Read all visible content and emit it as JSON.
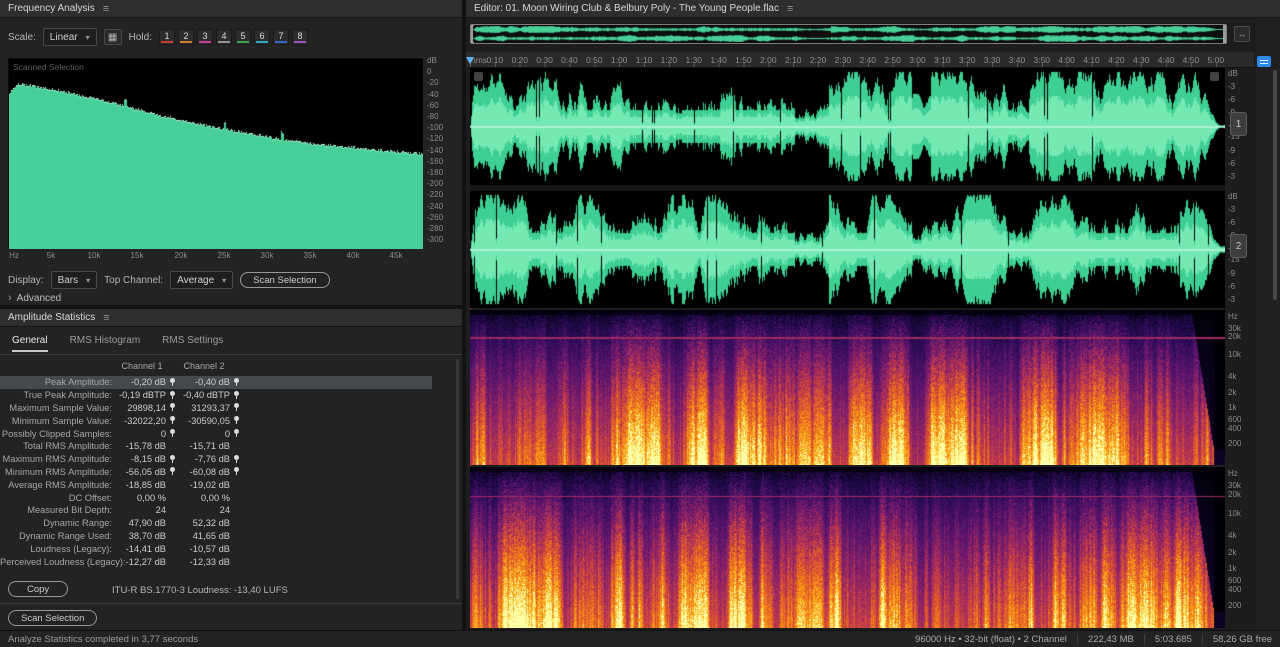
{
  "frequency_analysis": {
    "title": "Frequency Analysis",
    "scale_label": "Scale:",
    "scale_value": "Linear",
    "hold_label": "Hold:",
    "hold_buttons": [
      {
        "label": "1",
        "color": "#c8392f"
      },
      {
        "label": "2",
        "color": "#cf7c2a"
      },
      {
        "label": "3",
        "color": "#c73a96"
      },
      {
        "label": "4",
        "color": "#8f8f8f"
      },
      {
        "label": "5",
        "color": "#38a14b"
      },
      {
        "label": "6",
        "color": "#2fa7bd"
      },
      {
        "label": "7",
        "color": "#3465c8"
      },
      {
        "label": "8",
        "color": "#9b4fc4"
      }
    ],
    "graph_overlay": "Scanned Selection",
    "db_ticks": [
      "dB",
      "0",
      "-20",
      "-40",
      "-60",
      "-80",
      "-100",
      "-120",
      "-140",
      "-160",
      "-180",
      "-200",
      "-220",
      "-240",
      "-260",
      "-280",
      "-300"
    ],
    "freq_ticks": [
      "Hz",
      "5k",
      "10k",
      "15k",
      "20k",
      "25k",
      "30k",
      "35k",
      "40k",
      "45k"
    ],
    "display_label": "Display:",
    "display_value": "Bars",
    "top_channel_label": "Top Channel:",
    "top_channel_value": "Average",
    "scan_button": "Scan Selection",
    "advanced_label": "Advanced"
  },
  "amplitude_statistics": {
    "title": "Amplitude Statistics",
    "tabs": [
      {
        "label": "General",
        "active": true
      },
      {
        "label": "RMS Histogram",
        "active": false
      },
      {
        "label": "RMS Settings",
        "active": false
      }
    ],
    "columns": [
      "Channel 1",
      "Channel 2"
    ],
    "rows": [
      {
        "label": "Peak Amplitude:",
        "ch1": "-0,20 dB",
        "ch2": "-0,40 dB",
        "locate": true,
        "highlight": true
      },
      {
        "label": "True Peak Amplitude:",
        "ch1": "-0,19 dBTP",
        "ch2": "-0,40 dBTP",
        "locate": true
      },
      {
        "label": "Maximum Sample Value:",
        "ch1": "29898,14",
        "ch2": "31293,37",
        "locate": true
      },
      {
        "label": "Minimum Sample Value:",
        "ch1": "-32022,20",
        "ch2": "-30590,05",
        "locate": true
      },
      {
        "label": "Possibly Clipped Samples:",
        "ch1": "0",
        "ch2": "0",
        "locate": true
      },
      {
        "label": "Total RMS Amplitude:",
        "ch1": "-15,78 dB",
        "ch2": "-15,71 dB",
        "locate": false
      },
      {
        "label": "Maximum RMS Amplitude:",
        "ch1": "-8,15 dB",
        "ch2": "-7,76 dB",
        "locate": true
      },
      {
        "label": "Minimum RMS Amplitude:",
        "ch1": "-56,05 dB",
        "ch2": "-60,08 dB",
        "locate": true
      },
      {
        "label": "Average RMS Amplitude:",
        "ch1": "-18,85 dB",
        "ch2": "-19,02 dB",
        "locate": false
      },
      {
        "label": "DC Offset:",
        "ch1": "0,00 %",
        "ch2": "0,00 %",
        "locate": false
      },
      {
        "label": "Measured Bit Depth:",
        "ch1": "24",
        "ch2": "24",
        "locate": false
      },
      {
        "label": "Dynamic Range:",
        "ch1": "47,90 dB",
        "ch2": "52,32 dB",
        "locate": false
      },
      {
        "label": "Dynamic Range Used:",
        "ch1": "38,70 dB",
        "ch2": "41,65 dB",
        "locate": false
      },
      {
        "label": "Loudness (Legacy):",
        "ch1": "-14,41 dB",
        "ch2": "-10,57 dB",
        "locate": false
      },
      {
        "label": "Perceived Loudness (Legacy):",
        "ch1": "-12,27 dB",
        "ch2": "-12,33 dB",
        "locate": false
      }
    ],
    "copy_button": "Copy",
    "loudness_text": "ITU-R BS.1770-3 Loudness:  -13,40 LUFS",
    "scan_button": "Scan Selection"
  },
  "editor": {
    "title": "Editor: 01. Moon Wiring Club & Belbury Poly - The Young People.flac",
    "ruler_unit": "hms",
    "time_ticks": [
      "0:10",
      "0:20",
      "0:30",
      "0:40",
      "0:50",
      "1:00",
      "1:10",
      "1:20",
      "1:30",
      "1:40",
      "1:50",
      "2:00",
      "2:10",
      "2:20",
      "2:30",
      "2:40",
      "2:50",
      "3:00",
      "3:10",
      "3:20",
      "3:30",
      "3:40",
      "3:50",
      "4:00",
      "4:10",
      "4:20",
      "4:30",
      "4:40",
      "4:50",
      "5:00"
    ],
    "wave_db_ticks": [
      {
        "label": "dB",
        "off": 1
      },
      {
        "label": "-3",
        "off": 14
      },
      {
        "label": "-6",
        "off": 27
      },
      {
        "label": "-9",
        "off": 40
      },
      {
        "label": "-15",
        "off": 53
      },
      {
        "label": "-15",
        "off": 64
      },
      {
        "label": "-9",
        "off": 78
      },
      {
        "label": "-6",
        "off": 91
      },
      {
        "label": "-3",
        "off": 104
      }
    ],
    "channel_buttons": [
      "1",
      "2"
    ],
    "spec_freq_ticks": [
      {
        "label": "Hz",
        "pos": 0.01
      },
      {
        "label": "30k",
        "pos": 0.09
      },
      {
        "label": "20k",
        "pos": 0.145
      },
      {
        "label": "10k",
        "pos": 0.26
      },
      {
        "label": "4k",
        "pos": 0.4
      },
      {
        "label": "2k",
        "pos": 0.5
      },
      {
        "label": "1k",
        "pos": 0.6
      },
      {
        "label": "600",
        "pos": 0.675
      },
      {
        "label": "400",
        "pos": 0.735
      },
      {
        "label": "200",
        "pos": 0.835
      }
    ]
  },
  "status_bar": {
    "left": "Analyze Statistics completed in 3,77 seconds",
    "items": [
      "96000 Hz • 32-bit (float) • 2 Channel",
      "222,43 MB",
      "5:03.685",
      "58,26 GB free"
    ]
  }
}
